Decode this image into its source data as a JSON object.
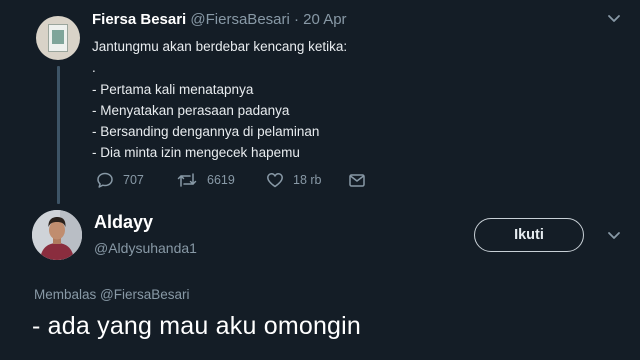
{
  "parent_tweet": {
    "name": "Fiersa Besari",
    "handle": "@FiersaBesari",
    "separator": "·",
    "date": "20 Apr",
    "lines": [
      "Jantungmu akan berdebar kencang ketika:",
      ".",
      "- Pertama kali menatapnya",
      "- Menyatakan perasaan padanya",
      "- Bersanding dengannya di pelaminan",
      "- Dia minta izin mengecek hapemu"
    ],
    "replies_count": "707",
    "retweets_count": "6619",
    "likes_count": "18 rb",
    "icons": [
      "reply-icon",
      "retweet-icon",
      "like-icon",
      "message-icon",
      "chevron-down-icon"
    ]
  },
  "reply_tweet": {
    "name": "Aldayy",
    "handle": "@Aldysuhanda1",
    "follow_label": "Ikuti",
    "replying_to": "Membalas @FiersaBesari",
    "text": "- ada yang mau aku omongin"
  },
  "colors": {
    "background": "#141d26",
    "secondary_text": "#8899a6",
    "thread_line": "#3d5466"
  }
}
